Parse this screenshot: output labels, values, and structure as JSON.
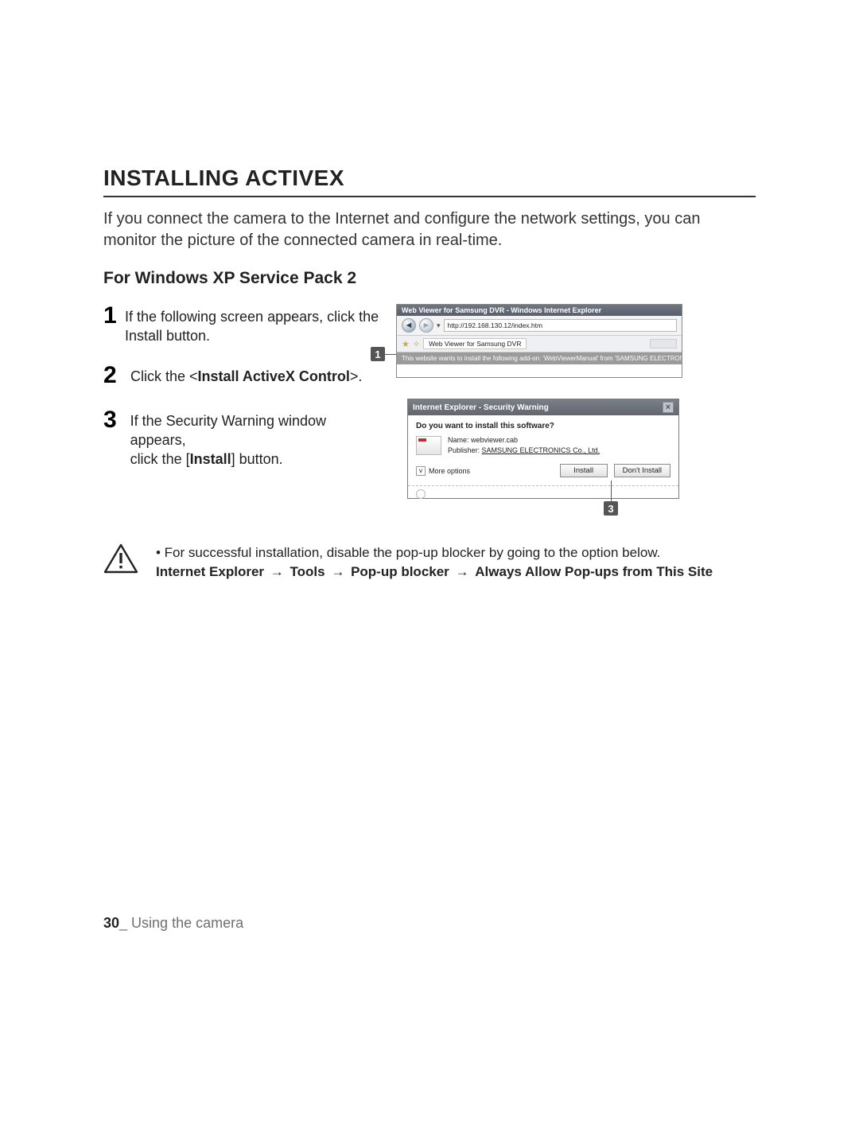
{
  "heading": "INSTALLING ACTIVEX",
  "intro": "If you connect the camera to the Internet and configure the network settings, you can monitor the picture of the connected camera in real-time.",
  "subhead": "For Windows XP Service Pack 2",
  "steps": {
    "s1": {
      "num": "1",
      "text": "If the following screen appears, click the Install button."
    },
    "s2": {
      "num": "2",
      "pre": "Click the <",
      "bold": "Install ActiveX Control",
      "post": ">."
    },
    "s3": {
      "num": "3",
      "line1": "If the Security Warning window appears,",
      "line2a": "click the [",
      "line2b": "Install",
      "line2c": "] button."
    }
  },
  "callouts": {
    "c1": "1",
    "c3": "3"
  },
  "ie": {
    "title": "Web Viewer for Samsung DVR - Windows Internet Explorer",
    "url": "http://192.168.130.12/index.htm",
    "tab": "Web Viewer for Samsung DVR",
    "infobar": "This website wants to install the following add-on: 'WebViewerManual' from 'SAMSUNG ELECTRONICS Co., Ltd.'"
  },
  "security": {
    "title": "Internet Explorer - Security Warning",
    "question": "Do you want to install this software?",
    "name_label": "Name:",
    "name_value": "webviewer.cab",
    "publisher_label": "Publisher:",
    "publisher_value": "SAMSUNG ELECTRONICS Co., Ltd.",
    "more": "More options",
    "install": "Install",
    "dont_install": "Don't Install"
  },
  "note": {
    "bullet": "• For successful installation, disable the pop-up blocker by going to the option below.",
    "path_parts": [
      "Internet Explorer",
      "Tools",
      "Pop-up blocker",
      "Always Allow Pop-ups from This Site"
    ],
    "arrow": "→"
  },
  "footer": {
    "page": "30",
    "sep": "_",
    "section": " Using the camera"
  }
}
